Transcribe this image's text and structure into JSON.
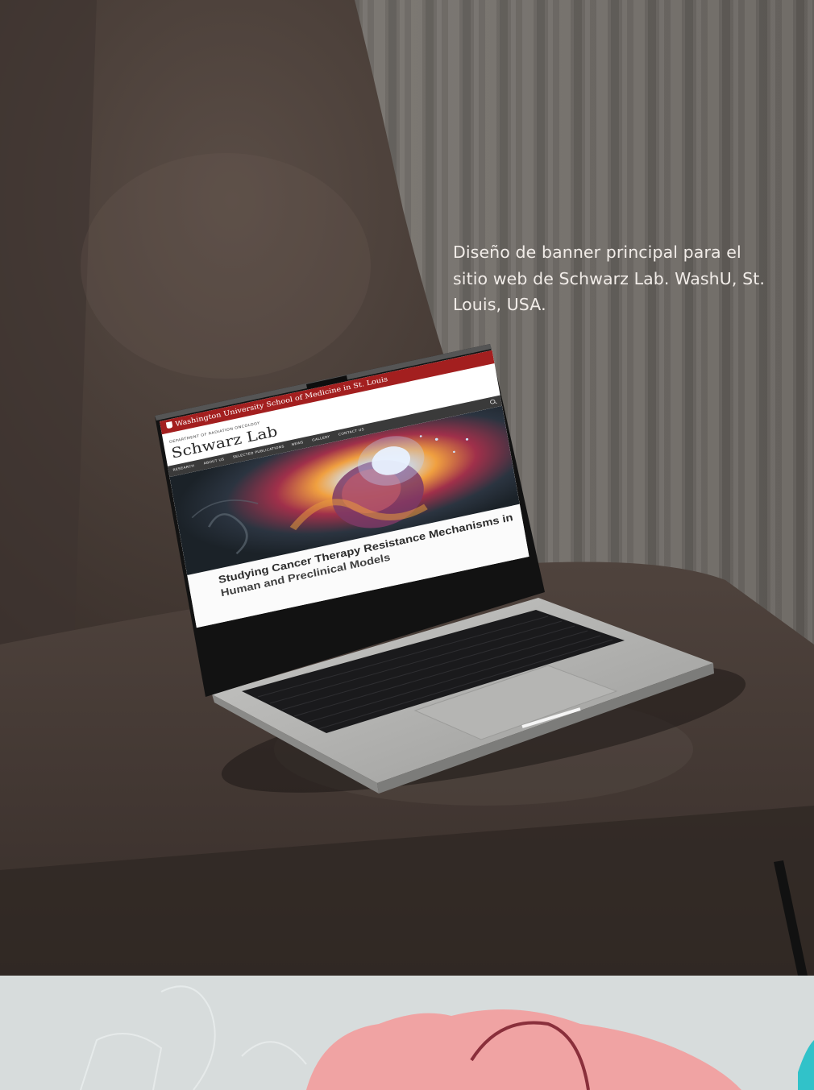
{
  "caption": {
    "text": "Diseño de banner principal para el sitio web de Schwarz Lab. WashU, St. Louis, USA."
  },
  "website": {
    "university_bar": "Washington University School of Medicine in St. Louis",
    "department": "DEPARTMENT OF RADIATION ONCOLOGY",
    "lab_name": "Schwarz Lab",
    "nav_items": [
      "RESEARCH",
      "ABOUT US",
      "SELECTED PUBLICATIONS",
      "NEWS",
      "GALLERY",
      "CONTACT US"
    ],
    "headline_line1": "Studying Cancer Therapy Resistance Mechanisms in",
    "headline_line2": "Human and Preclinical Models",
    "icons": [
      "search-icon"
    ]
  },
  "colors": {
    "washu_red": "#a31f1f",
    "sofa": "#4a3e38",
    "curtain": "#6e6a66",
    "bottom_panel": "#d7dcdc",
    "blob_pink": "#f0a3a3",
    "blob_teal": "#31c2c9"
  }
}
